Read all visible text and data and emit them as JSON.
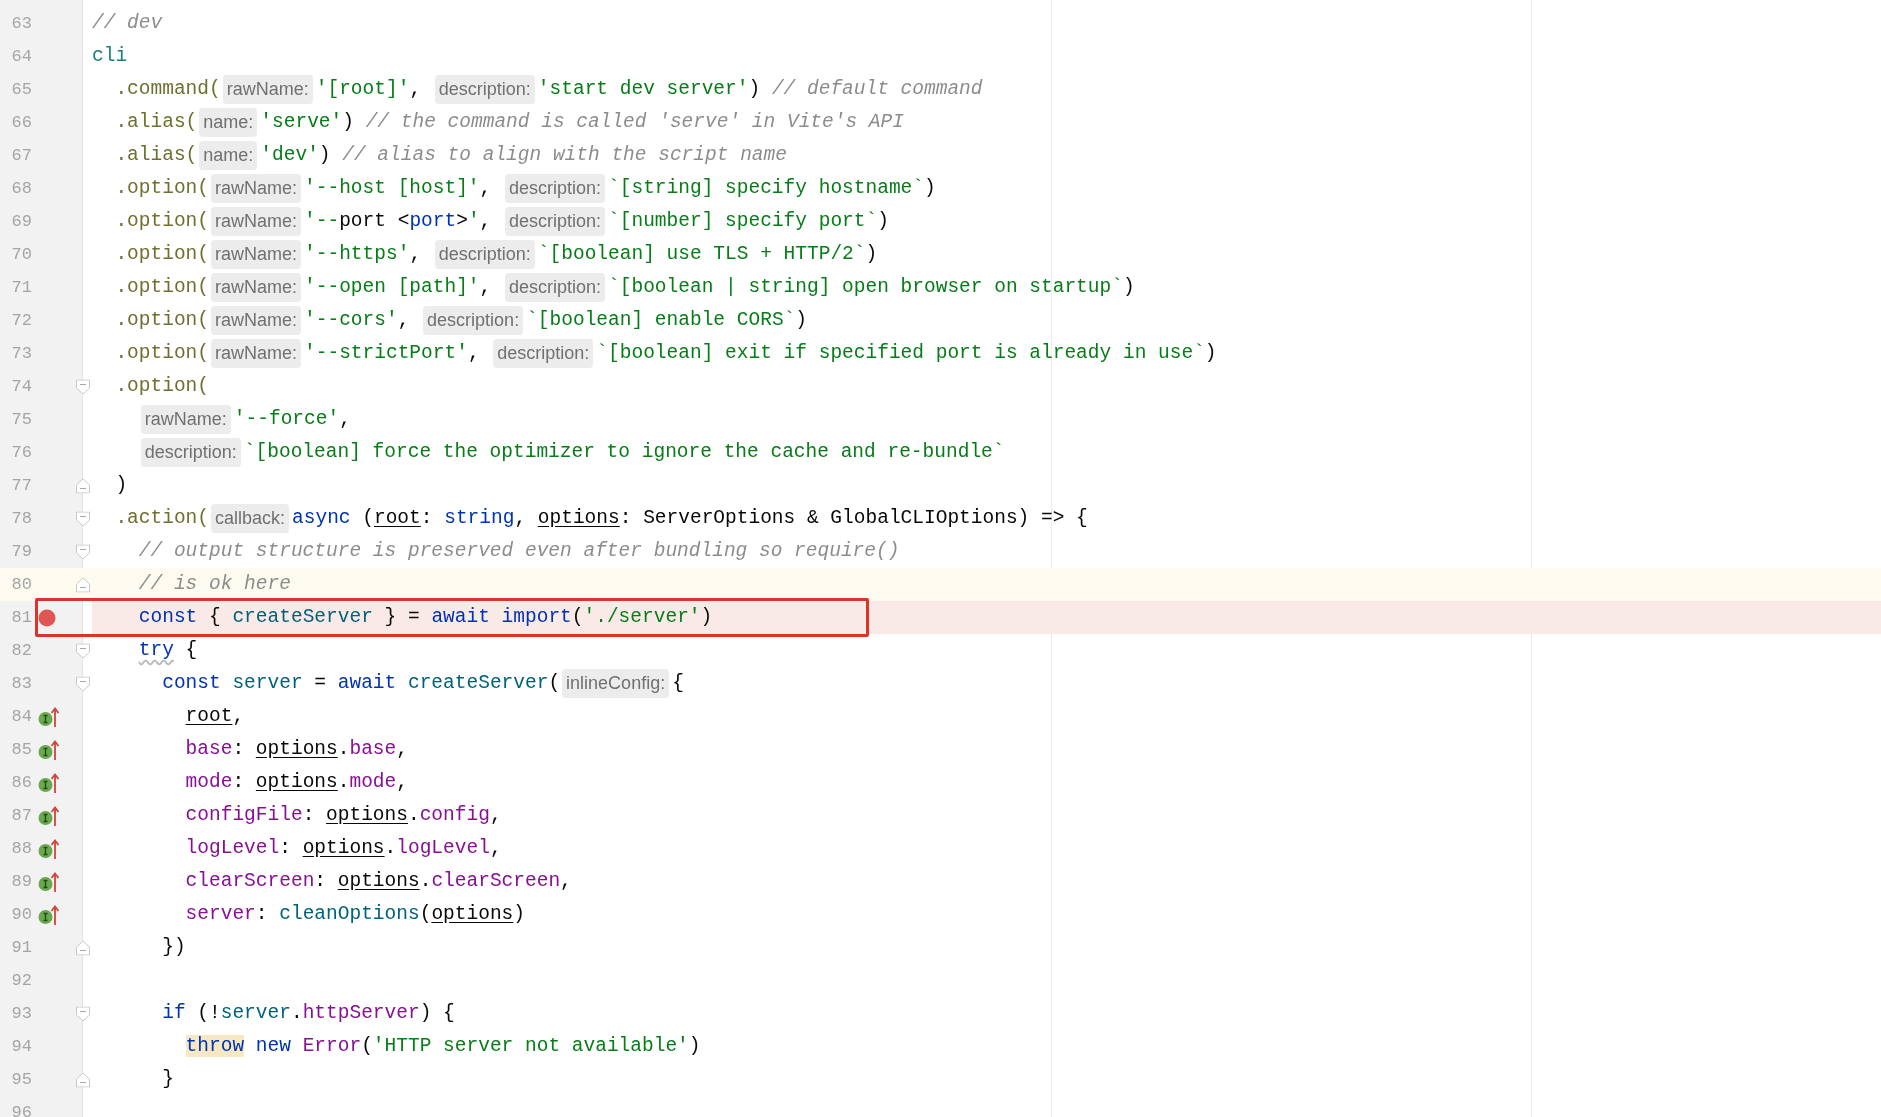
{
  "lines": [
    {
      "n": "63",
      "tokens": [
        {
          "kind": "comment",
          "text": "// dev"
        }
      ]
    },
    {
      "n": "64",
      "tokens": [
        {
          "kind": "var",
          "text": "cli"
        }
      ],
      "children": [
        {
          "n": "65",
          "tokens": [
            {
              "kind": "method",
              "text": ".command("
            },
            {
              "kind": "hint",
              "text": "rawName:"
            },
            {
              "kind": "string",
              "text": "'[root]'"
            },
            {
              "kind": "plain",
              "text": ", "
            },
            {
              "kind": "hint",
              "text": "description:"
            },
            {
              "kind": "string",
              "text": "'start dev server'"
            },
            {
              "kind": "plain",
              "text": ") "
            },
            {
              "kind": "comment",
              "text": "// default command"
            }
          ]
        },
        {
          "n": "66",
          "tokens": [
            {
              "kind": "method",
              "text": ".alias("
            },
            {
              "kind": "hint",
              "text": "name:"
            },
            {
              "kind": "string",
              "text": "'serve'"
            },
            {
              "kind": "plain",
              "text": ") "
            },
            {
              "kind": "comment",
              "text": "// the command is called 'serve' in Vite's API"
            }
          ]
        },
        {
          "n": "67",
          "tokens": [
            {
              "kind": "method",
              "text": ".alias("
            },
            {
              "kind": "hint",
              "text": "name:"
            },
            {
              "kind": "string",
              "text": "'dev'"
            },
            {
              "kind": "plain",
              "text": ") "
            },
            {
              "kind": "comment",
              "text": "// alias to align with the script name"
            }
          ]
        },
        {
          "n": "68",
          "tokens": [
            {
              "kind": "method",
              "text": ".option("
            },
            {
              "kind": "hint",
              "text": "rawName:"
            },
            {
              "kind": "string",
              "text": "'--host [host]'"
            },
            {
              "kind": "plain",
              "text": ", "
            },
            {
              "kind": "hint",
              "text": "description:"
            },
            {
              "kind": "string",
              "text": "`[string] specify hostname`"
            },
            {
              "kind": "plain",
              "text": ")"
            }
          ]
        },
        {
          "n": "69",
          "tokens": [
            {
              "kind": "method",
              "text": ".option("
            },
            {
              "kind": "hint",
              "text": "rawName:"
            },
            {
              "kind": "string",
              "text": "'--"
            },
            {
              "kind": "plain",
              "text": "port <"
            },
            {
              "kind": "keyword",
              "text": "port"
            },
            {
              "kind": "plain",
              "text": ">"
            },
            {
              "kind": "string",
              "text": "'"
            },
            {
              "kind": "plain",
              "text": ", "
            },
            {
              "kind": "hint",
              "text": "description:"
            },
            {
              "kind": "string",
              "text": "`[number] specify port`"
            },
            {
              "kind": "plain",
              "text": ")"
            }
          ]
        },
        {
          "n": "70",
          "tokens": [
            {
              "kind": "method",
              "text": ".option("
            },
            {
              "kind": "hint",
              "text": "rawName:"
            },
            {
              "kind": "string",
              "text": "'--https'"
            },
            {
              "kind": "plain",
              "text": ", "
            },
            {
              "kind": "hint",
              "text": "description:"
            },
            {
              "kind": "string",
              "text": "`[boolean] use TLS + HTTP/2`"
            },
            {
              "kind": "plain",
              "text": ")"
            }
          ]
        },
        {
          "n": "71",
          "tokens": [
            {
              "kind": "method",
              "text": ".option("
            },
            {
              "kind": "hint",
              "text": "rawName:"
            },
            {
              "kind": "string",
              "text": "'--open [path]'"
            },
            {
              "kind": "plain",
              "text": ", "
            },
            {
              "kind": "hint",
              "text": "description:"
            },
            {
              "kind": "string",
              "text": "`[boolean | string] open browser on startup`"
            },
            {
              "kind": "plain",
              "text": ")"
            }
          ]
        },
        {
          "n": "72",
          "tokens": [
            {
              "kind": "method",
              "text": ".option("
            },
            {
              "kind": "hint",
              "text": "rawName:"
            },
            {
              "kind": "string",
              "text": "'--cors'"
            },
            {
              "kind": "plain",
              "text": ", "
            },
            {
              "kind": "hint",
              "text": "description:"
            },
            {
              "kind": "string",
              "text": "`[boolean] enable CORS`"
            },
            {
              "kind": "plain",
              "text": ")"
            }
          ]
        },
        {
          "n": "73",
          "tokens": [
            {
              "kind": "method",
              "text": ".option("
            },
            {
              "kind": "hint",
              "text": "rawName:"
            },
            {
              "kind": "string",
              "text": "'--strictPort'"
            },
            {
              "kind": "plain",
              "text": ", "
            },
            {
              "kind": "hint",
              "text": "description:"
            },
            {
              "kind": "string",
              "text": "`[boolean] exit if specified port is already in use`"
            },
            {
              "kind": "plain",
              "text": ")"
            }
          ]
        },
        {
          "n": "74",
          "fold_start": true,
          "tokens": [
            {
              "kind": "method",
              "text": ".option("
            }
          ],
          "children": [
            {
              "n": "75",
              "tokens": [
                {
                  "kind": "hint",
                  "text": "rawName:"
                },
                {
                  "kind": "string",
                  "text": "'--force'"
                },
                {
                  "kind": "plain",
                  "text": ","
                }
              ]
            },
            {
              "n": "76",
              "tokens": [
                {
                  "kind": "hint",
                  "text": "description:"
                },
                {
                  "kind": "string",
                  "text": "`[boolean] force the optimizer to ignore the cache and re-bundle`"
                }
              ]
            }
          ]
        },
        {
          "n": "77",
          "fold_end": true,
          "tokens": [
            {
              "kind": "plain",
              "text": ")"
            }
          ]
        },
        {
          "n": "78",
          "fold_start": true,
          "tokens": [
            {
              "kind": "method",
              "text": ".action("
            },
            {
              "kind": "hint",
              "text": "callback:"
            },
            {
              "kind": "keyword",
              "text": "async"
            },
            {
              "kind": "plain",
              "text": " ("
            },
            {
              "kind": "param",
              "text": "root"
            },
            {
              "kind": "plain",
              "text": ": "
            },
            {
              "kind": "keyword",
              "text": "string"
            },
            {
              "kind": "plain",
              "text": ", "
            },
            {
              "kind": "param",
              "text": "options"
            },
            {
              "kind": "plain",
              "text": ": ServerOptions & GlobalCLIOptions) => {"
            }
          ],
          "children": [
            {
              "n": "79",
              "fold_start": true,
              "tokens": [
                {
                  "kind": "comment",
                  "text": "// output structure is preserved even after bundling so require()"
                }
              ]
            },
            {
              "n": "80",
              "fold_end": true,
              "caret_line": true,
              "tokens": [
                {
                  "kind": "comment",
                  "text": "// is ok here"
                }
              ]
            },
            {
              "n": "81",
              "breakpoint": true,
              "annotated": true,
              "tokens": [
                {
                  "kind": "keyword",
                  "text": "const"
                },
                {
                  "kind": "plain",
                  "text": " { "
                },
                {
                  "kind": "ident",
                  "text": "createServer"
                },
                {
                  "kind": "plain",
                  "text": " } = "
                },
                {
                  "kind": "keyword",
                  "text": "await import"
                },
                {
                  "kind": "plain",
                  "text": "("
                },
                {
                  "kind": "string",
                  "text": "'./server'"
                },
                {
                  "kind": "plain",
                  "text": ")"
                }
              ]
            },
            {
              "n": "82",
              "fold_start": true,
              "tokens": [
                {
                  "kind": "warn",
                  "text": "try"
                },
                {
                  "kind": "plain",
                  "text": " {"
                }
              ],
              "children": [
                {
                  "n": "83",
                  "fold_start": true,
                  "tokens": [
                    {
                      "kind": "keyword",
                      "text": "const"
                    },
                    {
                      "kind": "ident",
                      "text": " server"
                    },
                    {
                      "kind": "plain",
                      "text": " = "
                    },
                    {
                      "kind": "keyword",
                      "text": "await"
                    },
                    {
                      "kind": "ident",
                      "text": " createServer"
                    },
                    {
                      "kind": "plain",
                      "text": "("
                    },
                    {
                      "kind": "hint",
                      "text": "inlineConfig:"
                    },
                    {
                      "kind": "plain",
                      "text": "{"
                    }
                  ],
                  "children": [
                    {
                      "n": "84",
                      "implemented": true,
                      "tokens": [
                        {
                          "kind": "param",
                          "text": "root"
                        },
                        {
                          "kind": "plain",
                          "text": ","
                        }
                      ]
                    },
                    {
                      "n": "85",
                      "implemented": true,
                      "tokens": [
                        {
                          "kind": "prop",
                          "text": "base"
                        },
                        {
                          "kind": "plain",
                          "text": ": "
                        },
                        {
                          "kind": "param",
                          "text": "options"
                        },
                        {
                          "kind": "plain",
                          "text": "."
                        },
                        {
                          "kind": "prop",
                          "text": "base"
                        },
                        {
                          "kind": "plain",
                          "text": ","
                        }
                      ]
                    },
                    {
                      "n": "86",
                      "implemented": true,
                      "tokens": [
                        {
                          "kind": "prop",
                          "text": "mode"
                        },
                        {
                          "kind": "plain",
                          "text": ": "
                        },
                        {
                          "kind": "param",
                          "text": "options"
                        },
                        {
                          "kind": "plain",
                          "text": "."
                        },
                        {
                          "kind": "prop",
                          "text": "mode"
                        },
                        {
                          "kind": "plain",
                          "text": ","
                        }
                      ]
                    },
                    {
                      "n": "87",
                      "implemented": true,
                      "tokens": [
                        {
                          "kind": "prop",
                          "text": "configFile"
                        },
                        {
                          "kind": "plain",
                          "text": ": "
                        },
                        {
                          "kind": "param",
                          "text": "options"
                        },
                        {
                          "kind": "plain",
                          "text": "."
                        },
                        {
                          "kind": "prop",
                          "text": "config"
                        },
                        {
                          "kind": "plain",
                          "text": ","
                        }
                      ]
                    },
                    {
                      "n": "88",
                      "implemented": true,
                      "tokens": [
                        {
                          "kind": "prop",
                          "text": "logLevel"
                        },
                        {
                          "kind": "plain",
                          "text": ": "
                        },
                        {
                          "kind": "param",
                          "text": "options"
                        },
                        {
                          "kind": "plain",
                          "text": "."
                        },
                        {
                          "kind": "prop",
                          "text": "logLevel"
                        },
                        {
                          "kind": "plain",
                          "text": ","
                        }
                      ]
                    },
                    {
                      "n": "89",
                      "implemented": true,
                      "tokens": [
                        {
                          "kind": "prop",
                          "text": "clearScreen"
                        },
                        {
                          "kind": "plain",
                          "text": ": "
                        },
                        {
                          "kind": "param",
                          "text": "options"
                        },
                        {
                          "kind": "plain",
                          "text": "."
                        },
                        {
                          "kind": "prop",
                          "text": "clearScreen"
                        },
                        {
                          "kind": "plain",
                          "text": ","
                        }
                      ]
                    },
                    {
                      "n": "90",
                      "implemented": true,
                      "tokens": [
                        {
                          "kind": "prop",
                          "text": "server"
                        },
                        {
                          "kind": "plain",
                          "text": ": "
                        },
                        {
                          "kind": "ident",
                          "text": "cleanOptions"
                        },
                        {
                          "kind": "plain",
                          "text": "("
                        },
                        {
                          "kind": "param",
                          "text": "options"
                        },
                        {
                          "kind": "plain",
                          "text": ")"
                        }
                      ]
                    }
                  ]
                },
                {
                  "n": "91",
                  "fold_end": true,
                  "tokens": [
                    {
                      "kind": "plain",
                      "text": "})"
                    }
                  ]
                },
                {
                  "n": "92"
                },
                {
                  "n": "93",
                  "fold_start": true,
                  "tokens": [
                    {
                      "kind": "keyword",
                      "text": "if"
                    },
                    {
                      "kind": "plain",
                      "text": " (!"
                    },
                    {
                      "kind": "ident",
                      "text": "server"
                    },
                    {
                      "kind": "plain",
                      "text": "."
                    },
                    {
                      "kind": "prop",
                      "text": "httpServer"
                    },
                    {
                      "kind": "plain",
                      "text": ") {"
                    }
                  ],
                  "children": [
                    {
                      "n": "94",
                      "tokens": [
                        {
                          "kind": "mark",
                          "text": "throw"
                        },
                        {
                          "kind": "keyword",
                          "text": " new"
                        },
                        {
                          "kind": "prop",
                          "text": " Error"
                        },
                        {
                          "kind": "plain",
                          "text": "("
                        },
                        {
                          "kind": "string",
                          "text": "'HTTP server not available'"
                        },
                        {
                          "kind": "plain",
                          "text": ")"
                        }
                      ]
                    }
                  ]
                },
                {
                  "n": "95",
                  "fold_end": true,
                  "tokens": [
                    {
                      "kind": "plain",
                      "text": "}"
                    }
                  ]
                }
              ]
            }
          ]
        }
      ]
    },
    {
      "n": "96"
    }
  ]
}
